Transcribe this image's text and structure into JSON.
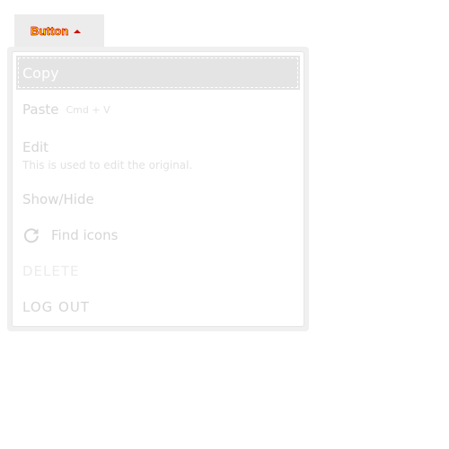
{
  "trigger": {
    "label": "Button",
    "icon": "caret-up-icon"
  },
  "menu": {
    "items": [
      {
        "id": "copy",
        "label": "Copy",
        "highlighted": true
      },
      {
        "id": "paste",
        "label": "Paste",
        "shortcut": "Cmd + V"
      },
      {
        "id": "edit",
        "label": "Edit",
        "description": "This is used to edit the original."
      },
      {
        "id": "showhide",
        "label": "Show/Hide"
      },
      {
        "id": "find",
        "label": "Find icons",
        "icon": "refresh-icon"
      },
      {
        "id": "delete",
        "label": "DELETE",
        "disabled": true
      },
      {
        "id": "logout",
        "label": "LOG OUT"
      }
    ]
  },
  "colors": {
    "trigger_background": "#ececec",
    "trigger_text": "#ffee00",
    "trigger_text_outline": "#d40000",
    "menu_item_text": "#d6d6d6",
    "highlight_background": "#e4e4e4"
  }
}
